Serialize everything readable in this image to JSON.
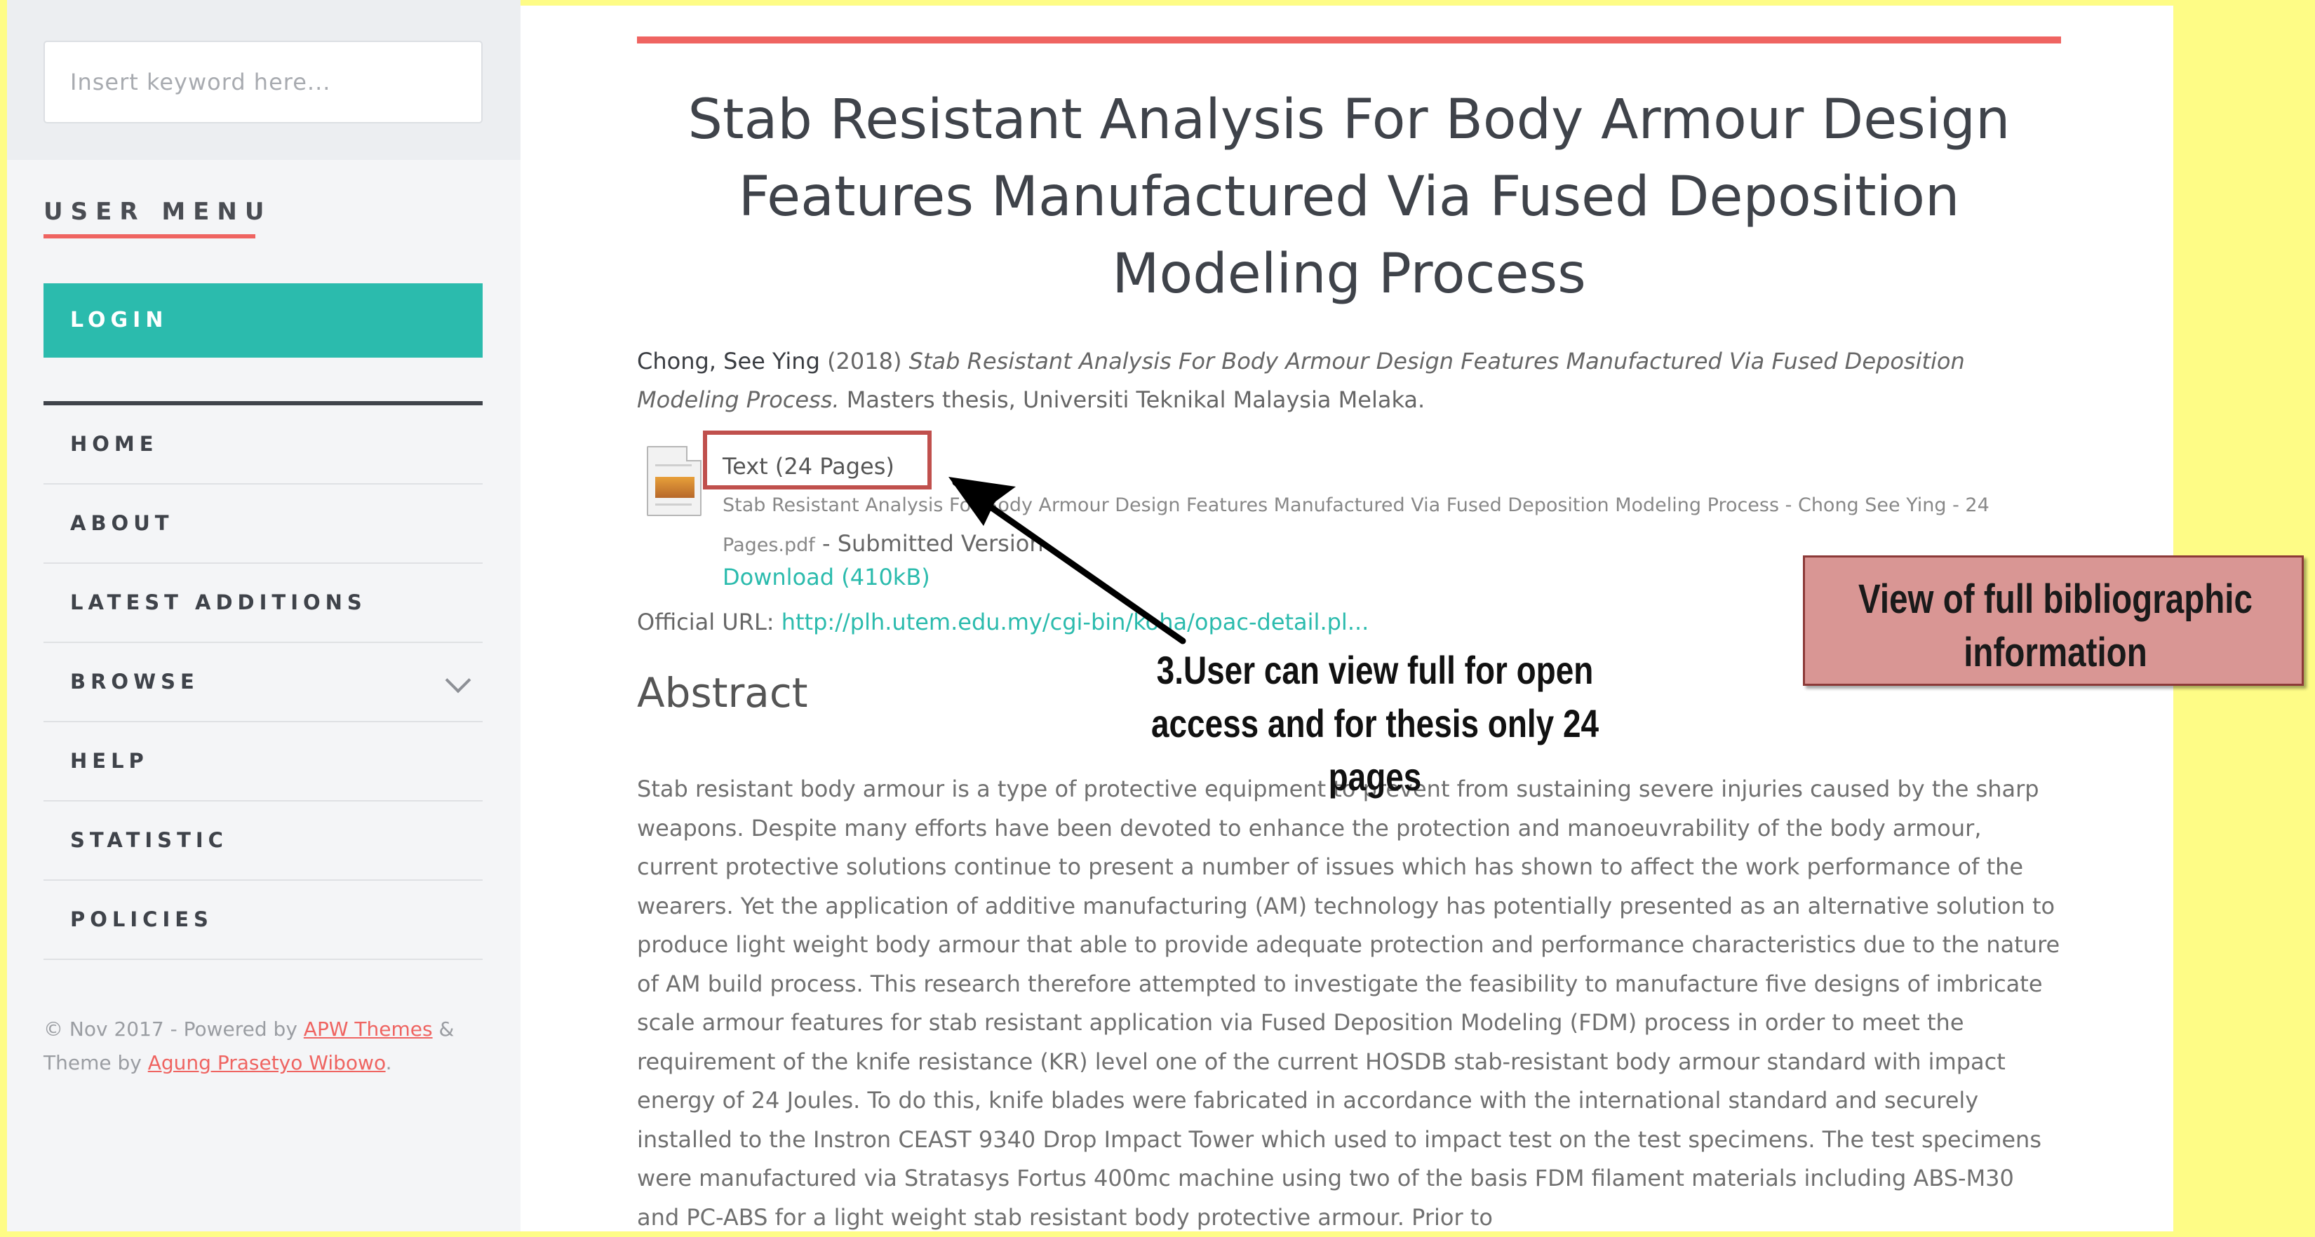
{
  "search": {
    "placeholder": "Insert keyword here..."
  },
  "sidebar": {
    "menu_heading": "USER MENU",
    "login_label": "LOGIN",
    "items": [
      {
        "label": "HOME"
      },
      {
        "label": "ABOUT"
      },
      {
        "label": "LATEST ADDITIONS"
      },
      {
        "label": "BROWSE",
        "icon": "chevron-down-icon"
      },
      {
        "label": "HELP"
      },
      {
        "label": "STATISTIC"
      },
      {
        "label": "POLICIES"
      }
    ],
    "footer": {
      "prefix": "© Nov 2017 - Powered by ",
      "powered_link": "APW Themes",
      "amp": " & ",
      "line2_prefix": "Theme by ",
      "theme_link": "Agung Prasetyo Wibowo",
      "suffix": "."
    }
  },
  "main": {
    "title": "Stab Resistant Analysis For Body Armour Design Features Manufactured Via Fused Deposition Modeling Process",
    "citation": {
      "author": "Chong, See Ying",
      "year": " (2018) ",
      "title": "Stab Resistant Analysis For Body Armour Design Features Manufactured Via Fused Deposition Modeling Process.",
      "rest": " Masters thesis, Universiti Teknikal Malaysia Melaka."
    },
    "document": {
      "icon": "pdf-document-icon",
      "type_label": "Text (24 Pages)",
      "filename": "Stab Resistant Analysis For Body Armour Design Features Manufactured Via Fused Deposition Modeling Process - Chong See Ying - 24 Pages.pdf",
      "version": " - Submitted Version",
      "download_label": "Download (410kB)"
    },
    "official_url": {
      "label": "Official URL: ",
      "link": "http://plh.utem.edu.my/cgi-bin/koha/opac-detail.pl..."
    },
    "abstract_heading": "Abstract",
    "abstract_text": "Stab resistant body armour is a type of protective equipment to prevent from sustaining severe injuries caused by the sharp weapons. Despite many efforts have been devoted to enhance the protection and manoeuvrability of the body armour, current protective solutions continue to present a number of issues which has shown to affect the work performance of the wearers. Yet the application of additive manufacturing (AM) technology has potentially presented as an alternative solution to produce light weight body armour that able to provide adequate protection and performance characteristics due to the nature of AM build process. This research therefore attempted to investigate the feasibility to manufacture five designs of imbricate scale armour features for stab resistant application via Fused Deposition Modeling (FDM) process in order to meet the requirement of the knife resistance (KR) level one of the current HOSDB stab-resistant body armour standard with impact energy of 24 Joules. To do this, knife blades were fabricated in accordance with the international standard and securely installed to the Instron CEAST 9340 Drop Impact Tower which used to impact test on the test specimens. The test specimens were manufactured via Stratasys Fortus 400mc machine using two of the basis FDM filament materials including ABS-M30 and PC-ABS for a light weight stab resistant body protective armour. Prior to"
  },
  "annotations": {
    "arrow_callout": "3.User can view full for open access and for thesis only 24 pages",
    "box_callout": "View of full bibliographic information",
    "colors": {
      "highlight": "#c0504d",
      "callout_fill": "#d99694",
      "page_background": "#fefc86",
      "accent": "#ef6461",
      "teal": "#2bbbad"
    }
  }
}
